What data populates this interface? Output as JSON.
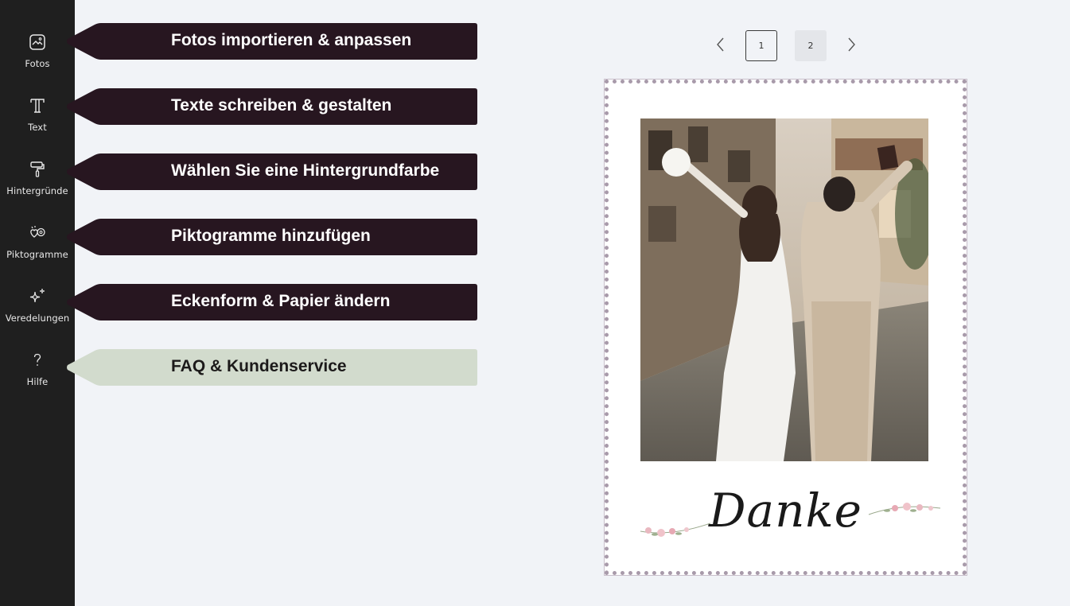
{
  "sidebar": {
    "items": [
      {
        "label": "Fotos",
        "icon": "photo-icon"
      },
      {
        "label": "Text",
        "icon": "text-icon"
      },
      {
        "label": "Hintergründe",
        "icon": "paint-roller-icon"
      },
      {
        "label": "Piktogramme",
        "icon": "pictogram-icon"
      },
      {
        "label": "Veredelungen",
        "icon": "sparkle-icon"
      },
      {
        "label": "Hilfe",
        "icon": "help-icon"
      }
    ]
  },
  "banners": [
    {
      "text": "Fotos importieren & anpassen"
    },
    {
      "text": "Texte schreiben & gestalten"
    },
    {
      "text": "Wählen Sie eine Hintergrundfarbe"
    },
    {
      "text": "Piktogramme hinzufügen"
    },
    {
      "text": "Eckenform & Papier ändern"
    },
    {
      "text": "FAQ & Kundenservice"
    }
  ],
  "colors": {
    "sidebar_bg": "#1f1f1f",
    "banner_dark": "#271620",
    "banner_light": "#d2dbcd",
    "page_bg": "#f1f3f7",
    "card_border": "#a89aaa"
  },
  "pagination": {
    "prev_icon": "chevron-left-icon",
    "next_icon": "chevron-right-icon",
    "pages": [
      "1",
      "2"
    ],
    "current": "1"
  },
  "card": {
    "greeting": "Danke",
    "photo_description": "wedding-couple-photo"
  }
}
